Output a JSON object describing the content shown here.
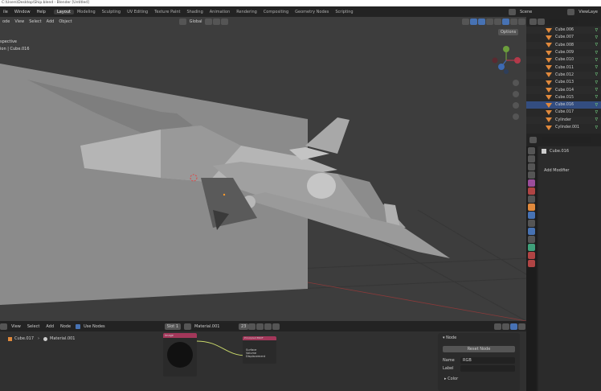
{
  "window": {
    "title": "C:\\Users\\Desktop\\Ship.blend - Blender [Untitled]"
  },
  "topbar": {
    "menus": [
      "ile",
      "Window",
      "Help"
    ],
    "workspaces": [
      "Layout",
      "Modeling",
      "Sculpting",
      "UV Editing",
      "Texture Paint",
      "Shading",
      "Animation",
      "Rendering",
      "Compositing",
      "Geometry Nodes",
      "Scripting"
    ],
    "active_workspace": "Layout",
    "scene_label": "Scene",
    "view_layer_label": "ViewLaye"
  },
  "viewport": {
    "menus": [
      "ode",
      "View",
      "Select",
      "Add",
      "Object"
    ],
    "transform_orientation": "Global",
    "options_label": "Options",
    "overlay_text": [
      "spective",
      "ion | Cube.016"
    ]
  },
  "outliner": {
    "items": [
      "Cube.006",
      "Cube.007",
      "Cube.008",
      "Cube.009",
      "Cube.010",
      "Cube.011",
      "Cube.012",
      "Cube.013",
      "Cube.014",
      "Cube.015",
      "Cube.016",
      "Cube.017",
      "Cylinder",
      "Cylinder.001"
    ]
  },
  "properties": {
    "object_name": "Cube.016",
    "add_modifier": "Add Modifier"
  },
  "node_editor": {
    "menus": [
      "View",
      "Select",
      "Add",
      "Node"
    ],
    "use_nodes_label": "Use Nodes",
    "slot": "Slot 1",
    "material": "Material.001",
    "user_count": "23",
    "breadcrumb_object": "Cube.017",
    "breadcrumb_material": "Material.001",
    "image_node_title": "Image",
    "bsdf_title": "Principled BSDF",
    "bsdf_inputs": [
      "Surface",
      "Volume",
      "Displacement"
    ]
  },
  "n_panel": {
    "section": "Node",
    "reset_label": "Reset Node",
    "name_label": "Name",
    "name_value": "RGB",
    "label_label": "Label",
    "color_label": "Color"
  },
  "colors": {
    "accent": "#4772b3",
    "object_orange": "#e0893c",
    "visible_green": "#6cc27a",
    "image_node_header": "#a3375a"
  }
}
